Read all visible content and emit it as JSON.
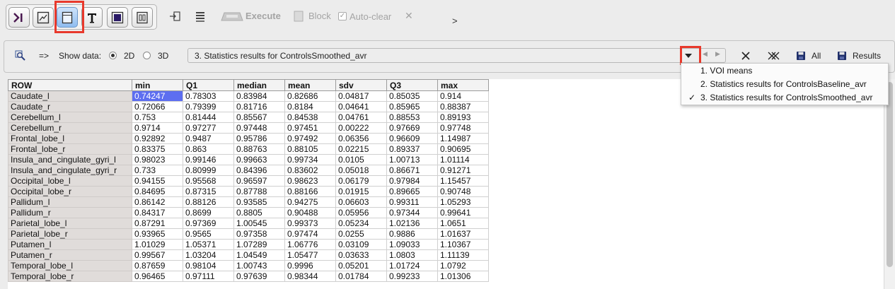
{
  "toolbar": {
    "execute_label": "Execute",
    "block_label": "Block",
    "autoclear_label": "Auto-clear",
    "more_label": ">"
  },
  "data_panel": {
    "arrow_label": "=>",
    "show_data_label": "Show data:",
    "radio_2d_label": "2D",
    "radio_3d_label": "3D",
    "selected_dataset": "3. Statistics results for ControlsSmoothed_avr",
    "save_all_label": "All",
    "save_results_label": "Results"
  },
  "dropdown": {
    "items": [
      {
        "label": "1. VOI means",
        "checked": ""
      },
      {
        "label": "2. Statistics results for ControlsBaseline_avr",
        "checked": ""
      },
      {
        "label": "3. Statistics results for ControlsSmoothed_avr",
        "checked": "✓"
      }
    ]
  },
  "table": {
    "columns": [
      "ROW",
      "min",
      "Q1",
      "median",
      "mean",
      "sdv",
      "Q3",
      "max"
    ],
    "rows": [
      [
        "Caudate_l",
        "0.74247",
        "0.78303",
        "0.83984",
        "0.82686",
        "0.04817",
        "0.85035",
        "0.914"
      ],
      [
        "Caudate_r",
        "0.72066",
        "0.79399",
        "0.81716",
        "0.8184",
        "0.04641",
        "0.85965",
        "0.88387"
      ],
      [
        "Cerebellum_l",
        "0.753",
        "0.81444",
        "0.85567",
        "0.84538",
        "0.04761",
        "0.88553",
        "0.89193"
      ],
      [
        "Cerebellum_r",
        "0.9714",
        "0.97277",
        "0.97448",
        "0.97451",
        "0.00222",
        "0.97669",
        "0.97748"
      ],
      [
        "Frontal_lobe_l",
        "0.92892",
        "0.9487",
        "0.95786",
        "0.97492",
        "0.06356",
        "0.96609",
        "1.14987"
      ],
      [
        "Frontal_lobe_r",
        "0.83375",
        "0.863",
        "0.88763",
        "0.88105",
        "0.02215",
        "0.89337",
        "0.90695"
      ],
      [
        "Insula_and_cingulate_gyri_l",
        "0.98023",
        "0.99146",
        "0.99663",
        "0.99734",
        "0.0105",
        "1.00713",
        "1.01114"
      ],
      [
        "Insula_and_cingulate_gyri_r",
        "0.733",
        "0.80999",
        "0.84396",
        "0.83602",
        "0.05018",
        "0.86671",
        "0.91271"
      ],
      [
        "Occipital_lobe_l",
        "0.94155",
        "0.95568",
        "0.96597",
        "0.98623",
        "0.06179",
        "0.97984",
        "1.15457"
      ],
      [
        "Occipital_lobe_r",
        "0.84695",
        "0.87315",
        "0.87788",
        "0.88166",
        "0.01915",
        "0.89665",
        "0.90748"
      ],
      [
        "Pallidum_l",
        "0.86142",
        "0.88126",
        "0.93585",
        "0.94275",
        "0.06603",
        "0.99311",
        "1.05293"
      ],
      [
        "Pallidum_r",
        "0.84317",
        "0.8699",
        "0.8805",
        "0.90488",
        "0.05956",
        "0.97344",
        "0.99641"
      ],
      [
        "Parietal_lobe_l",
        "0.87291",
        "0.97369",
        "1.00545",
        "0.99373",
        "0.05234",
        "1.02136",
        "1.0651"
      ],
      [
        "Parietal_lobe_r",
        "0.93965",
        "0.9565",
        "0.97358",
        "0.97474",
        "0.0255",
        "0.9886",
        "1.01637"
      ],
      [
        "Putamen_l",
        "1.01029",
        "1.05371",
        "1.07289",
        "1.06776",
        "0.03109",
        "1.09033",
        "1.10367"
      ],
      [
        "Putamen_r",
        "0.99567",
        "1.03204",
        "1.04549",
        "1.05477",
        "0.03633",
        "1.0803",
        "1.11139"
      ],
      [
        "Temporal_lobe_l",
        "0.87659",
        "0.98104",
        "1.00743",
        "0.9996",
        "0.05201",
        "1.01724",
        "1.0792"
      ],
      [
        "Temporal_lobe_r",
        "0.96465",
        "0.97111",
        "0.97639",
        "0.98344",
        "0.01784",
        "0.99233",
        "1.01306"
      ]
    ]
  },
  "colors": {
    "highlight_red": "#e8392c",
    "selected_cell": "#5d6ef0",
    "active_mode": "#8fbdf0"
  }
}
